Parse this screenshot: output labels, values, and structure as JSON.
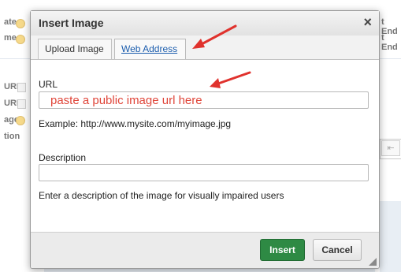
{
  "background": {
    "left_labels": [
      "ate",
      "me",
      "URL",
      "URL",
      "age",
      "tion"
    ],
    "right_labels": [
      "t End",
      "t End"
    ]
  },
  "dialog": {
    "title": "Insert Image",
    "close_glyph": "×",
    "tabs": [
      {
        "label": "Upload Image",
        "active": false
      },
      {
        "label": "Web Address",
        "active": true
      }
    ],
    "url": {
      "label": "URL",
      "value": "",
      "placeholder": "paste a public image url here",
      "help": "Example: http://www.mysite.com/myimage.jpg"
    },
    "description": {
      "label": "Description",
      "value": "",
      "help": "Enter a description of the image for visually impaired users"
    },
    "buttons": {
      "insert": "Insert",
      "cancel": "Cancel"
    }
  },
  "annotation_color": "#e0322d",
  "accent_color": "#2e8a44"
}
